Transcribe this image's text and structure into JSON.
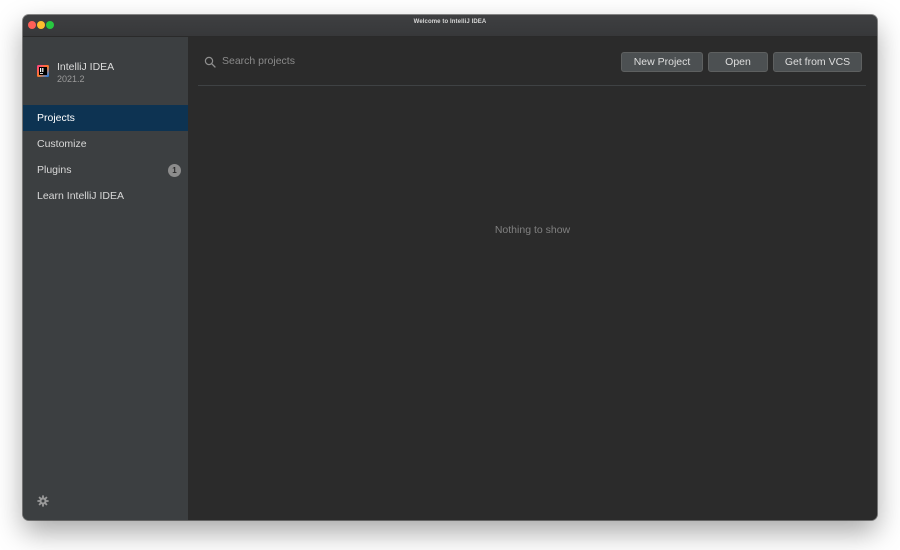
{
  "window": {
    "title": "Welcome to IntelliJ IDEA"
  },
  "sidebar": {
    "app_name": "IntelliJ IDEA",
    "app_version": "2021.2",
    "logo_icon": "intellij-logo-icon",
    "items": [
      {
        "label": "Projects",
        "active": true
      },
      {
        "label": "Customize",
        "active": false
      },
      {
        "label": "Plugins",
        "active": false,
        "badge": "1"
      },
      {
        "label": "Learn IntelliJ IDEA",
        "active": false
      }
    ],
    "settings_icon": "gear-icon"
  },
  "main": {
    "search": {
      "placeholder": "Search projects",
      "value": "",
      "icon": "search-icon"
    },
    "buttons": {
      "new_project": "New Project",
      "open": "Open",
      "get_from_vcs": "Get from VCS"
    },
    "empty_text": "Nothing to show"
  },
  "colors": {
    "sidebar_bg": "#3c3f41",
    "main_bg": "#2b2b2b",
    "selection": "#0d3352",
    "button_bg": "#4c5052"
  }
}
